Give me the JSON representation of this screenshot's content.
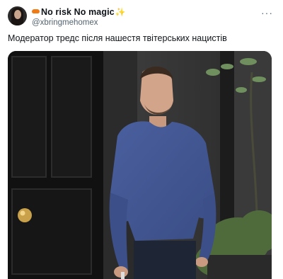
{
  "author": {
    "display_name": "No risk No magic",
    "handle": "@xbringmehomex",
    "emoji_prefix": "lips-emoji",
    "emoji_suffix": "sparkles-emoji"
  },
  "post": {
    "text": "Модератор тредс після нашестя твітерських нацистів"
  },
  "icons": {
    "more": "more-horizontal-icon"
  },
  "colors": {
    "text_primary": "#0f1419",
    "text_secondary": "#536471",
    "background": "#ffffff"
  }
}
